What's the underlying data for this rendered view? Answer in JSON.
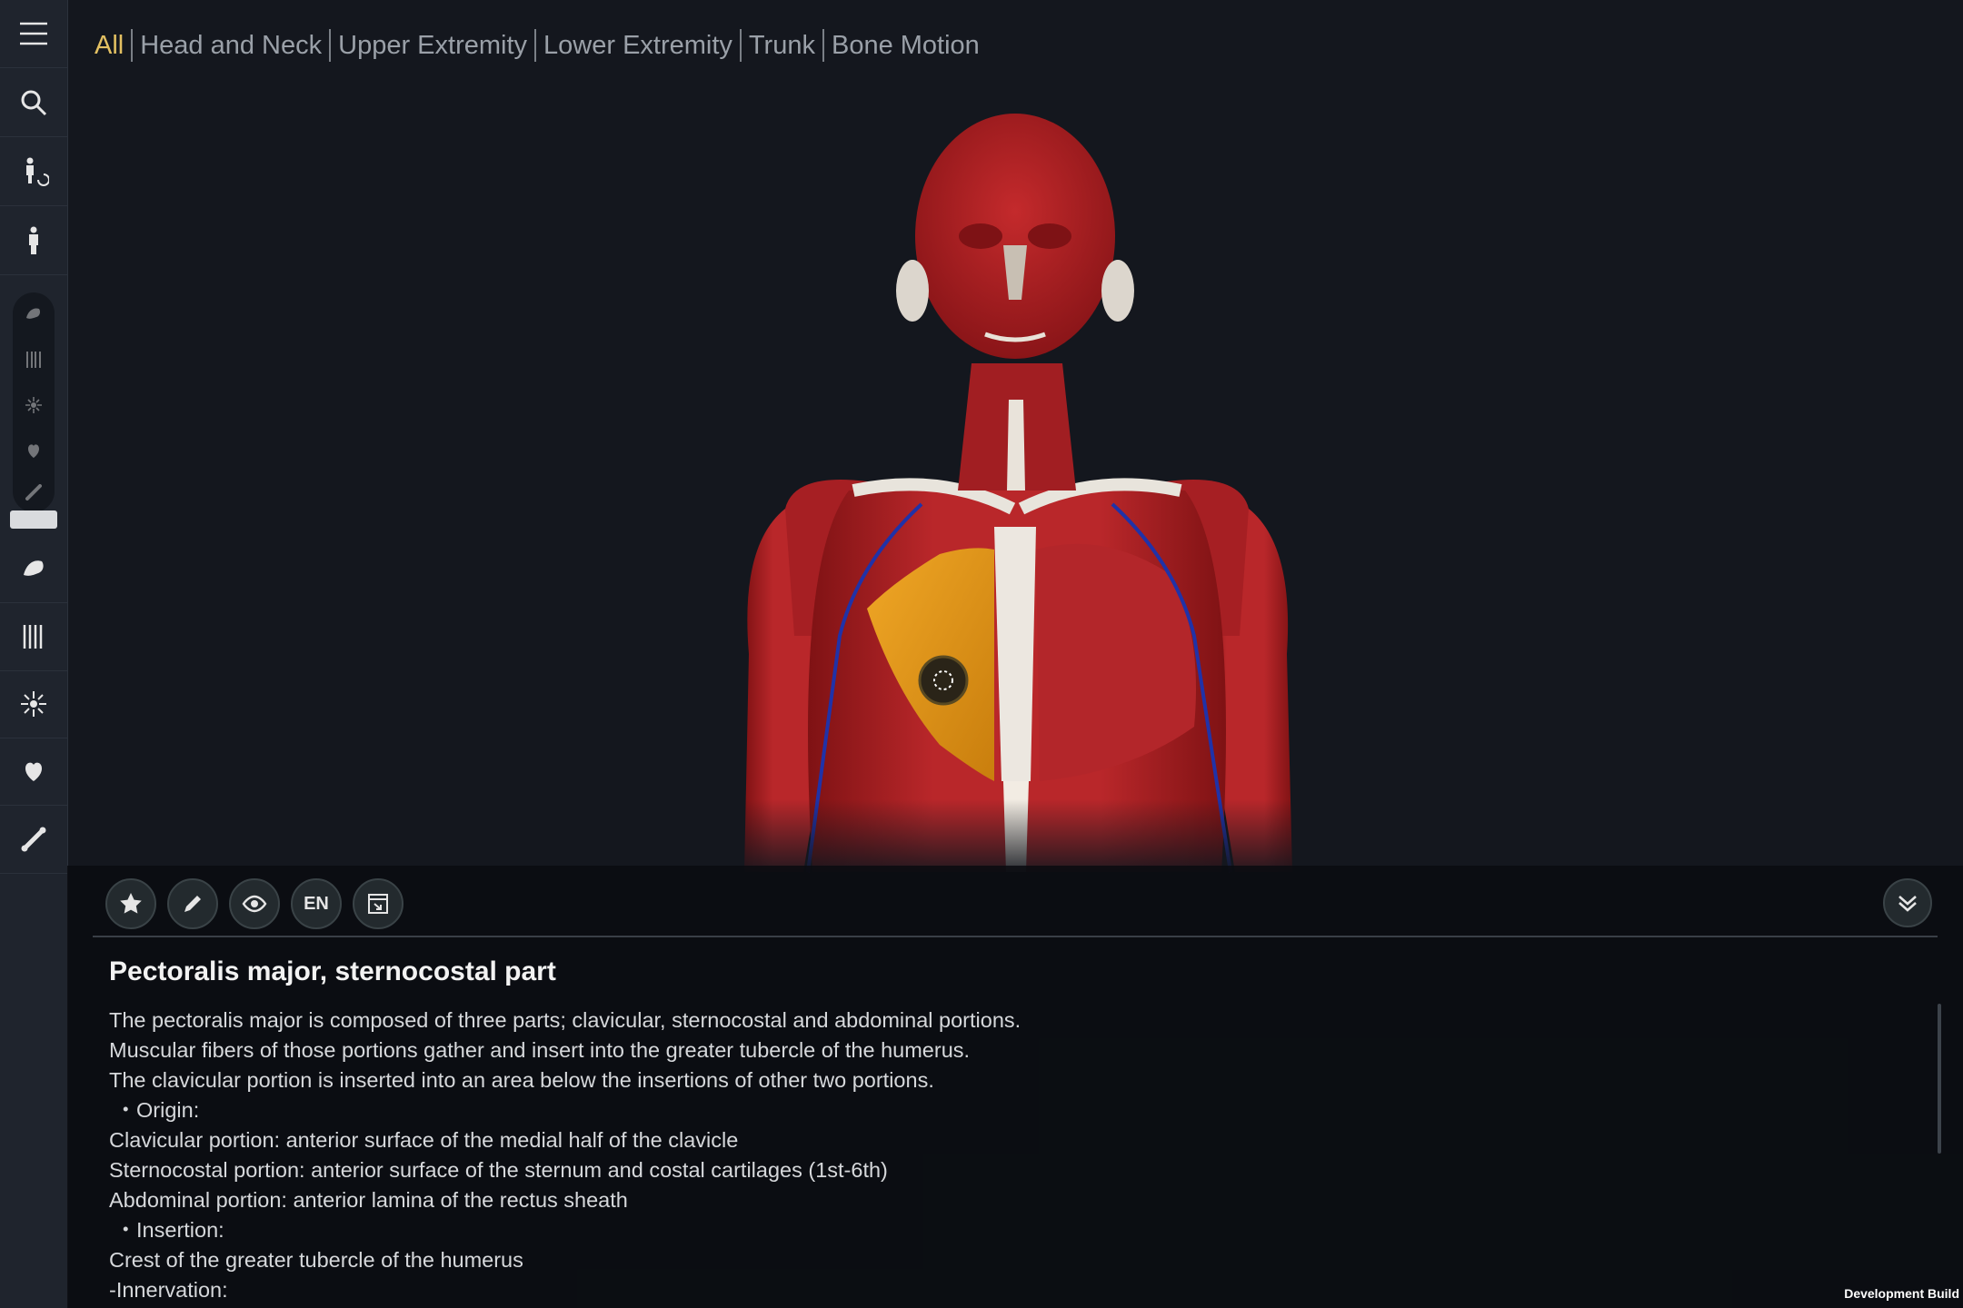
{
  "tabs": [
    {
      "label": "All",
      "active": true
    },
    {
      "label": "Head and Neck",
      "active": false
    },
    {
      "label": "Upper Extremity",
      "active": false
    },
    {
      "label": "Lower Extremity",
      "active": false
    },
    {
      "label": "Trunk",
      "active": false
    },
    {
      "label": "Bone Motion",
      "active": false
    }
  ],
  "sidebar": {
    "icons": [
      "menu-icon",
      "search-icon",
      "rotate-body-icon",
      "standing-body-icon",
      "muscle-icon",
      "fascia-icon",
      "nerve-icon",
      "organ-icon",
      "bone-icon"
    ],
    "layer_group_icons": [
      "muscle-icon",
      "fascia-icon",
      "nerve-icon",
      "organ-icon",
      "bone-icon"
    ]
  },
  "toolbar": {
    "language_label": "EN"
  },
  "info": {
    "title": "Pectoralis major, sternocostal part",
    "lines": [
      "The pectoralis major is composed of three parts; clavicular, sternocostal and abdominal portions.",
      "Muscular fibers of those portions gather and insert into the greater tubercle of the humerus.",
      "The clavicular portion is inserted into an area below the insertions of other two portions.",
      " ・Origin:",
      "Clavicular portion: anterior surface of the medial half of the clavicle",
      "Sternocostal portion: anterior surface of the sternum and costal cartilages (1st-6th)",
      "Abdominal portion: anterior lamina of the rectus sheath",
      " ・Insertion:",
      "Crest of the greater tubercle of the humerus",
      "-Innervation:"
    ]
  },
  "footer": {
    "build_label": "Development Build"
  },
  "colors": {
    "accent_tab": "#e3c062",
    "muscle": "#b52326",
    "highlight": "#e39a1a",
    "background": "#14171e"
  }
}
